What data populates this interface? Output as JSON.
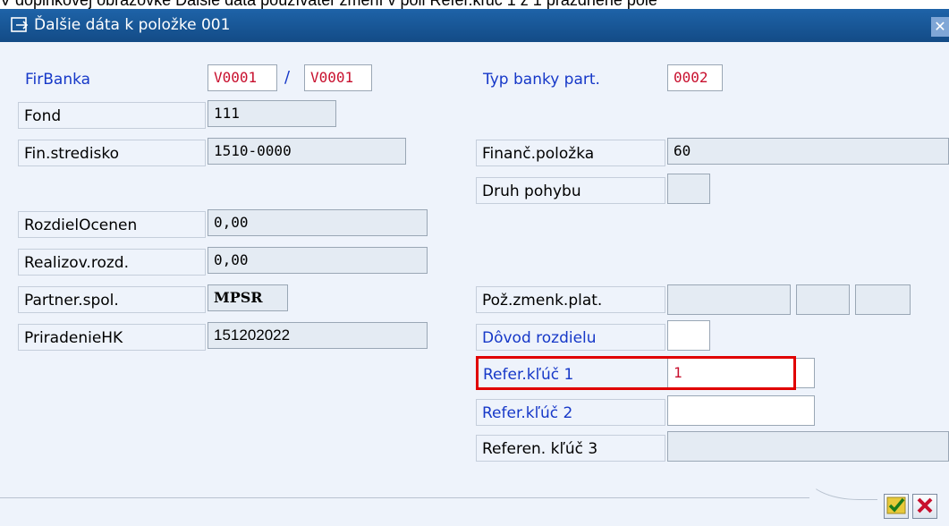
{
  "caption": "V doplnkovej obrazovke Ďalšie dáta používateľ zmení v poli Refer.kľúč 1 z 1 prázdnené pole",
  "title": "Ďalšie dáta k položke 001",
  "close_label": "✕",
  "left": {
    "firbanka": {
      "label": "FirBanka",
      "value1": "V0001",
      "separator": "/",
      "value2": "V0001"
    },
    "fond": {
      "label": "Fond",
      "value": "111"
    },
    "fin_stredisko": {
      "label": "Fin.stredisko",
      "value": "1510-0000"
    },
    "rozdiel_ocenen": {
      "label": "RozdielOcenen",
      "value": "0,00"
    },
    "realizov_rozd": {
      "label": "Realizov.rozd.",
      "value": "0,00"
    },
    "partner_spol": {
      "label": "Partner.spol.",
      "value": "MPSR"
    },
    "priradenie_hk": {
      "label": "PriradenieHK",
      "value": "151202022"
    }
  },
  "right": {
    "typ_banky": {
      "label": "Typ banky part.",
      "value": "0002"
    },
    "financ_polozka": {
      "label": "Finanč.položka",
      "value": "60"
    },
    "druh_pohybu": {
      "label": "Druh pohybu",
      "value": ""
    },
    "poz_zmenk_plat": {
      "label": "Pož.zmenk.plat.",
      "value1": "",
      "value2": "",
      "value3": ""
    },
    "dovod_rozdielu": {
      "label": "Dôvod rozdielu",
      "value": ""
    },
    "refer_kluc_1": {
      "label": "Refer.kľúč 1",
      "value": "1"
    },
    "refer_kluc_2": {
      "label": "Refer.kľúč 2",
      "value": ""
    },
    "referen_kluc_3": {
      "label": "Referen. kľúč 3",
      "value": ""
    }
  },
  "buttons": {
    "ok_icon": "checkmark-icon",
    "cancel_icon": "cancel-x-icon"
  },
  "colors": {
    "title_bar": "#1e63a8",
    "highlight": "#e00000",
    "required_label": "#1638c8",
    "red_value": "#c8102e"
  }
}
